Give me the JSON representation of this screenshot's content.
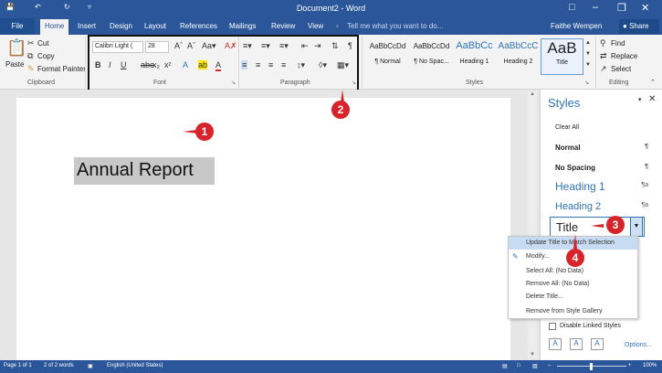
{
  "window": {
    "title": "Document2 - Word",
    "user": "Faithe Wempen",
    "share_label": "Share"
  },
  "tabs": {
    "file": "File",
    "items": [
      "Home",
      "Insert",
      "Design",
      "Layout",
      "References",
      "Mailings",
      "Review",
      "View"
    ],
    "active": "Home",
    "tell_me": "Tell me what you want to do..."
  },
  "clipboard": {
    "paste": "Paste",
    "cut": "Cut",
    "copy": "Copy",
    "format_painter": "Format Painter",
    "group_label": "Clipboard"
  },
  "font": {
    "name": "Calibri Light (",
    "size": "28",
    "group_label": "Font"
  },
  "paragraph": {
    "group_label": "Paragraph"
  },
  "styles_gallery": {
    "items": [
      {
        "sample": "AaBbCcDd",
        "name": "¶ Normal"
      },
      {
        "sample": "AaBbCcDd",
        "name": "¶ No Spac..."
      },
      {
        "sample": "AaBbCc",
        "name": "Heading 1"
      },
      {
        "sample": "AaBbCcC",
        "name": "Heading 2"
      },
      {
        "sample": "AaB",
        "name": "Title"
      }
    ],
    "group_label": "Styles"
  },
  "editing": {
    "find": "Find",
    "replace": "Replace",
    "select": "Select",
    "group_label": "Editing"
  },
  "document": {
    "selected_text": "Annual Report"
  },
  "styles_pane": {
    "title": "Styles",
    "clear_all": "Clear All",
    "items": [
      {
        "label": "Normal",
        "mark": "¶"
      },
      {
        "label": "No Spacing",
        "mark": "¶"
      },
      {
        "label": "Heading 1",
        "mark": "¶a"
      },
      {
        "label": "Heading 2",
        "mark": "¶a"
      },
      {
        "label": "Title",
        "mark": "¶a"
      }
    ],
    "disable_linked": "Disable Linked Styles",
    "options": "Options..."
  },
  "context_menu": {
    "items": [
      "Update Title to Match Selection",
      "Modify...",
      "Select All: (No Data)",
      "Remove All: (No Data)",
      "Delete Title...",
      "Remove from Style Gallery"
    ]
  },
  "callouts": [
    "1",
    "2",
    "3",
    "4"
  ],
  "status": {
    "page": "Page 1 of 1",
    "words": "2 of 2 words",
    "language": "English (United States)",
    "zoom": "100%"
  },
  "colors": {
    "accent": "#2b579a",
    "callout": "#d8232a",
    "heading_blue": "#2e74b5"
  }
}
